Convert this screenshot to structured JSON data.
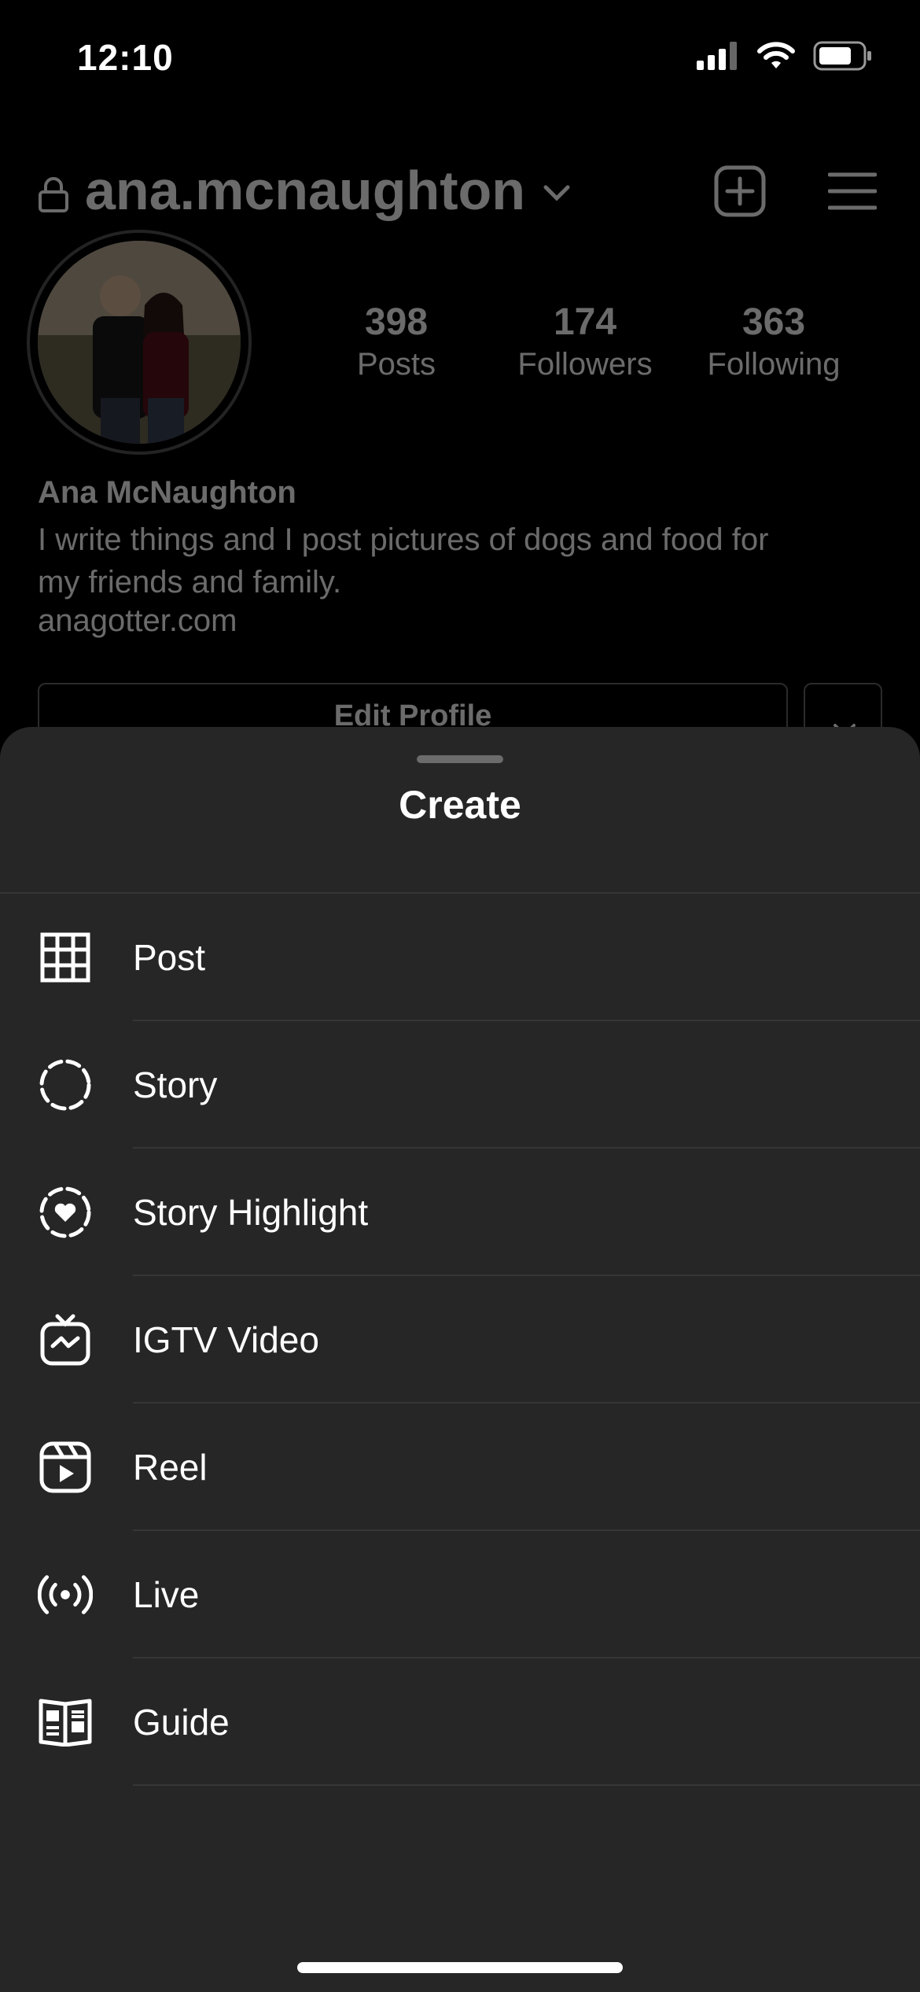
{
  "status_bar": {
    "time": "12:10"
  },
  "profile": {
    "username": "ana.mcnaughton",
    "stats": [
      {
        "value": "398",
        "label": "Posts"
      },
      {
        "value": "174",
        "label": "Followers"
      },
      {
        "value": "363",
        "label": "Following"
      }
    ],
    "name": "Ana McNaughton",
    "bio_line1": "I write things and I post pictures of dogs and food for",
    "bio_line2": "my friends and family.",
    "website": "anagotter.com",
    "edit_profile_label": "Edit Profile"
  },
  "sheet": {
    "title": "Create",
    "items": [
      {
        "label": "Post",
        "icon": "grid-icon"
      },
      {
        "label": "Story",
        "icon": "story-icon"
      },
      {
        "label": "Story Highlight",
        "icon": "story-highlight-icon"
      },
      {
        "label": "IGTV Video",
        "icon": "igtv-icon"
      },
      {
        "label": "Reel",
        "icon": "reel-icon"
      },
      {
        "label": "Live",
        "icon": "live-icon"
      },
      {
        "label": "Guide",
        "icon": "guide-icon"
      }
    ]
  },
  "colors": {
    "sheet_background": "#262626",
    "background": "#000000",
    "divider": "#363636"
  }
}
